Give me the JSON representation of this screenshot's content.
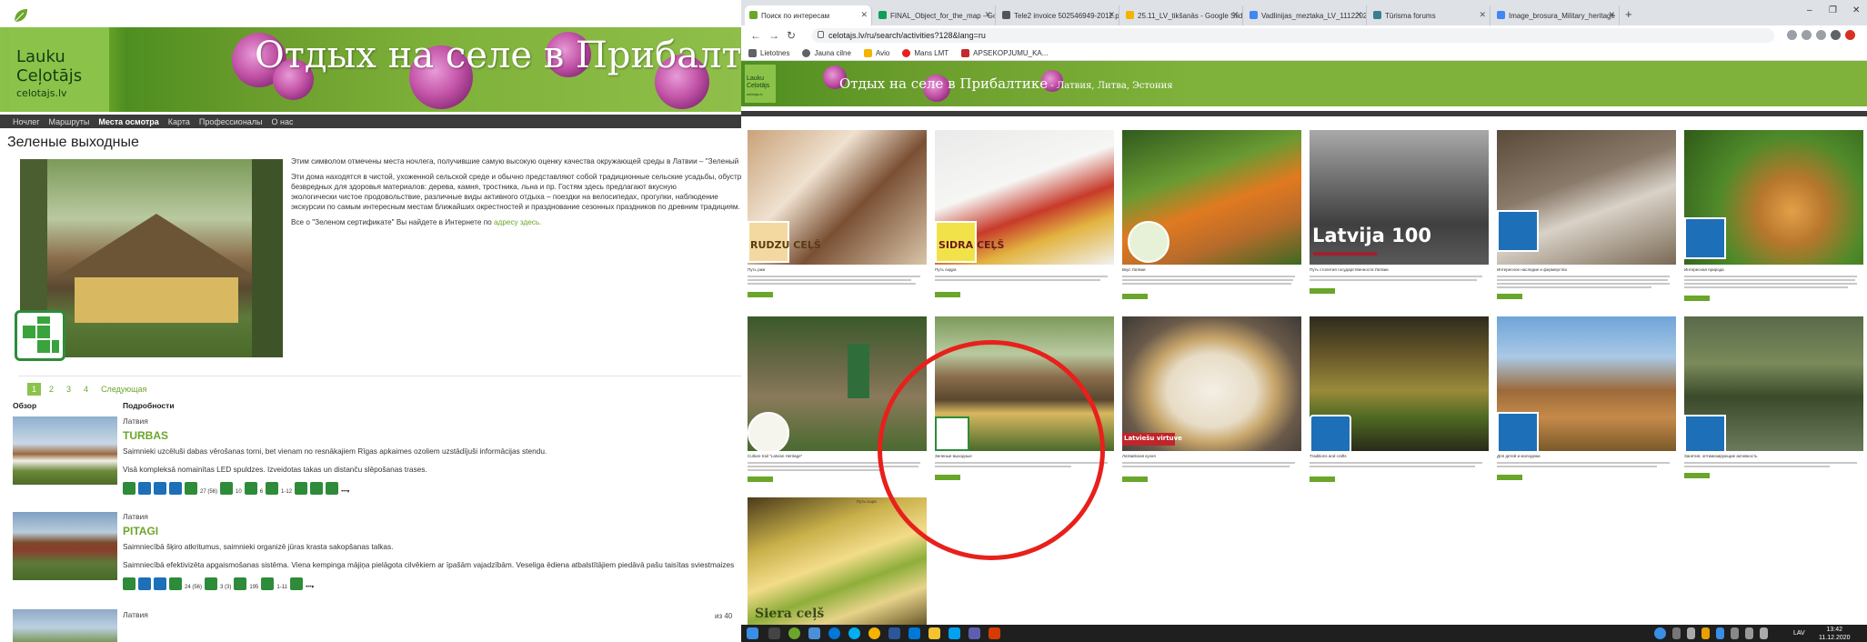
{
  "left_page": {
    "logo": {
      "line1": "Lauku",
      "line2": "Ceļotājs",
      "url": "celotajs.lv"
    },
    "banner_title": "Отдых на селе в Прибалтике",
    "nav": [
      "Ночлег",
      "Маршруты",
      "Места осмотра",
      "Карта",
      "Профессионалы",
      "О нас"
    ],
    "nav_active": "Места осмотра",
    "page_title": "Зеленые выходные",
    "intro": {
      "p1": "Этим символом отмечены места ночлега, получившие самую высокую оценку качества окружающей среды в Латвии – \"Зеленый сертификат\".",
      "p2a": "Эти дома находятся в чистой, ухоженной сельской среде и обычно представляют собой традиционные сельские усадьбы, обустроенные",
      "p2b": "безвредных для здоровья материалов: дерева, камня, тростника, льна и пр. Гостям здесь предлагают вкусную",
      "p2c": "экологически чистое продовольствие, различные виды активного отдыха – поездки на велосипедах, прогулки, наблюдение",
      "p2d": "экскурсии по самым интересным местам ближайших окрестностей и празднование сезонных праздников по древним традициям.",
      "p3_text": "Все о \"Зеленом сертификате\" Вы найдете в Интернете по ",
      "p3_link": "адресу здесь."
    },
    "pager": {
      "pages": [
        "1",
        "2",
        "3",
        "4"
      ],
      "current": "1",
      "next": "Следующая"
    },
    "table_headers": {
      "overview": "Обзор",
      "details": "Подробности"
    },
    "rows": [
      {
        "country": "Латвия",
        "name": "TURBAS",
        "desc1": "Saimnieki uzcēluši dabas vērošanas torni, bet vienam no resnākajiem Rīgas apkaimes ozoliem uzstādījuši informācijas stendu.",
        "desc2": "Visā kompleksā nomainītas LED spuldzes. Izveidotas takas un distanču slēpošanas trases."
      },
      {
        "country": "Латвия",
        "name": "PITAGI",
        "desc1": "Saimniecībā šķiro atkritumus, saimnieki organizē jūras krasta sakopšanas talkas.",
        "desc2": "Saimniecībā efektivizēta apgaismošanas sistēma. Viena kempinga mājiņa pielāgota cilvēkiem ar īpašām vajadzībām. Veseliga ēdiena atbalstītājiem piedāvā pašu taisītas sviestmaizes"
      },
      {
        "country": "Латвия"
      }
    ],
    "row_counts": [
      "27 (56)",
      "10",
      "6",
      "1-12"
    ],
    "row2_counts": [
      "24 (56)",
      "3 (3)",
      "195",
      "1-11"
    ],
    "scroll_count": "из 40"
  },
  "browser": {
    "tabs": [
      {
        "label": "Поиск по интересам",
        "active": true,
        "color": "#6aa62a"
      },
      {
        "label": "FINAL_Object_for_the_map - Go",
        "active": false,
        "color": "#0f9d58"
      },
      {
        "label": "Tele2 invoice 502546949-2012.p",
        "active": false,
        "color": "#555555"
      },
      {
        "label": "25.11_LV_tikšanās - Google Slid",
        "active": false,
        "color": "#f4b400"
      },
      {
        "label": "Vadlinijas_meztaka_LV_11122020",
        "active": false,
        "color": "#4285f4"
      },
      {
        "label": "Tūrisma forums",
        "active": false,
        "color": "#3a7f8f"
      },
      {
        "label": "Image_brosura_Military_heritage",
        "active": false,
        "color": "#4285f4"
      }
    ],
    "url": "celotajs.lv/ru/search/activities?128&lang=ru",
    "bookmarks": [
      "Lietotnes",
      "Jauna cilne",
      "Avio",
      "Mans LMT",
      "APSEKOPJUMU_KA..."
    ],
    "window_controls": [
      "–",
      "❐",
      "✕"
    ]
  },
  "site": {
    "logo": {
      "l1": "Lauku",
      "l2": "Ceļotājs",
      "l3": "celotajs.lv"
    },
    "banner_title": "Отдых на селе в Прибалтике",
    "banner_sub": " - Латвия, Литва, Эстония",
    "cards": [
      {
        "title": "Путь ржи",
        "label": "RUDZU CEĻŠ"
      },
      {
        "title": "Путь сидра",
        "label": "SIDRA CEĻŠ"
      },
      {
        "title": "Вкус Латвии",
        "label": ""
      },
      {
        "title": "Путь столетия государственности Латвии",
        "label": "Latvija 100"
      },
      {
        "title": "Интересное наследие и фермерство",
        "label": ""
      },
      {
        "title": "Интересная природа",
        "label": ""
      },
      {
        "title": "Culture trail \"Latvian Heritage\"",
        "label": ""
      },
      {
        "title": "Зеленые выходные",
        "label": ""
      },
      {
        "title": "Латвийская кухня",
        "label": "Latviešu virtuve"
      },
      {
        "title": "Traditions and crafts",
        "label": ""
      },
      {
        "title": "Для детей и молодежи",
        "label": ""
      },
      {
        "title": "Занятия, оптимизирующие активность",
        "label": ""
      },
      {
        "title": "Путь сыра",
        "label": "Siera ceļš"
      }
    ]
  },
  "taskbar": {
    "lang": "LAV",
    "time": "13:42",
    "date": "11.12.2020"
  },
  "colors": {
    "brand_green": "#6aa62a",
    "annotation_red": "#e8201c",
    "badge_blue": "#1d6fb8"
  }
}
